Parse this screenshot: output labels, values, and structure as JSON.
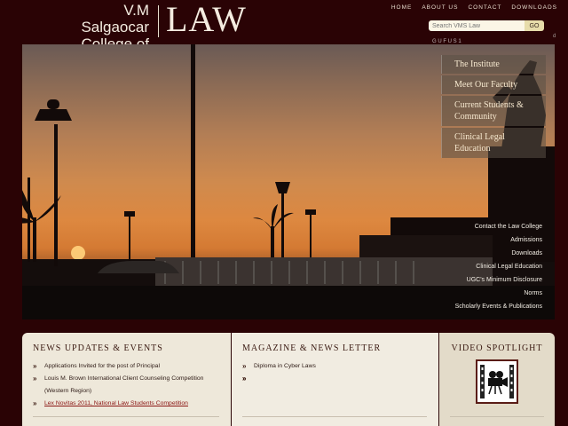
{
  "header": {
    "logo_line1": "V.M Salgaocar",
    "logo_line2": "College of",
    "logo_law": "LAW"
  },
  "topnav": [
    "HOME",
    "ABOUT US",
    "CONTACT",
    "DOWNLOADS"
  ],
  "search": {
    "placeholder": "Search VMS Law",
    "button_label": "GO",
    "hint": "d"
  },
  "hero": {
    "stray_text": "G U  F U S 1",
    "menu": [
      "The Institute",
      "Meet Our Faculty",
      "Current Students & Community",
      "Clinical Legal Education"
    ],
    "links": [
      "Contact the Law College",
      "Admissions",
      "Downloads",
      "Clinical Legal Education",
      "UGC's Minimum Disclosure",
      "Norms",
      "Scholarly Events & Publications"
    ]
  },
  "news": {
    "title": "NEWS UPDATES & EVENTS",
    "items": [
      "Applications Invited for the post of Principal",
      "Louis M. Brown International Client Counseling Competition",
      "(Western Region)",
      "Lex Novitas 2011, National Law Students Competition"
    ]
  },
  "magazine": {
    "title": "MAGAZINE & NEWS LETTER",
    "items": [
      "Diploma in Cyber Laws",
      "",
      "",
      ""
    ]
  },
  "video": {
    "title": "VIDEO SPOTLIGHT",
    "icon": "film-camera-icon"
  },
  "colors": {
    "background": "#2a0305",
    "panel": "#eee8da",
    "link_red": "#8a1412"
  }
}
